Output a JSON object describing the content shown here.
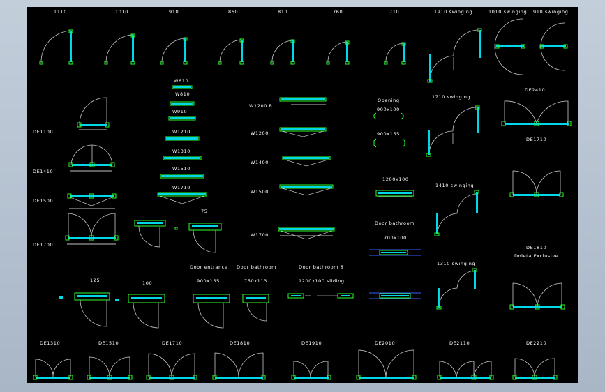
{
  "labels": {
    "d1110": "1110",
    "d1010": "1010",
    "d910": "910",
    "d860": "860",
    "d810": "810",
    "d760": "760",
    "d710": "710",
    "s1910": "1910 swinging",
    "s1010": "1010 swinging",
    "s910": "910 swinging",
    "w610": "W610",
    "w810": "W810",
    "w910": "W910",
    "w1210": "W1210",
    "w1310": "W1310",
    "w1510": "W1510",
    "w1710": "W1710",
    "w1200r": "W1200 R",
    "w1200": "W1200",
    "w1400": "W1400",
    "w1500": "W1500",
    "w1700": "W1700",
    "opening": "Opening",
    "o900x100": "900x100",
    "o900x155": "900x155",
    "s1710": "1710 swinging",
    "de2410": "DE2410",
    "de1100": "DE1100",
    "de1410": "DE1410",
    "de1500": "DE1500",
    "de1700": "DE1700",
    "de1710": "DE1710",
    "b1200x100": "1200x100",
    "s1410": "1410 swinging",
    "n75": "75",
    "door_bathroom_a": "Door bathroom",
    "b700x100": "700x100",
    "de1810": "DE1810",
    "doleta": "Doleta Exclusive",
    "s1310": "1310 swinging",
    "door_entrance": "Door entrance",
    "door_bathroom_b": "Door bathroom",
    "door_bathroom_8": "Door bathroom 8",
    "n125": "125",
    "n100": "100",
    "e900x155": "900x155",
    "e750x113": "750x113",
    "sl1200x100": "1200x100 sliding",
    "de1310": "DE1310",
    "de1510": "DE1510",
    "de1710b": "DE1710",
    "de1810b": "DE1810",
    "de1910": "DE1910",
    "de2010": "DE2010",
    "de2110": "DE2110",
    "de2210": "DE2210"
  },
  "colors": {
    "background": "#000000",
    "frame": "#2bff2b",
    "door_leaf": "#00d8e8",
    "swing_arc": "#c8c8c8",
    "text": "#ffffff",
    "wall_blue": "#3a5cff",
    "window": "#a8b6c6"
  }
}
